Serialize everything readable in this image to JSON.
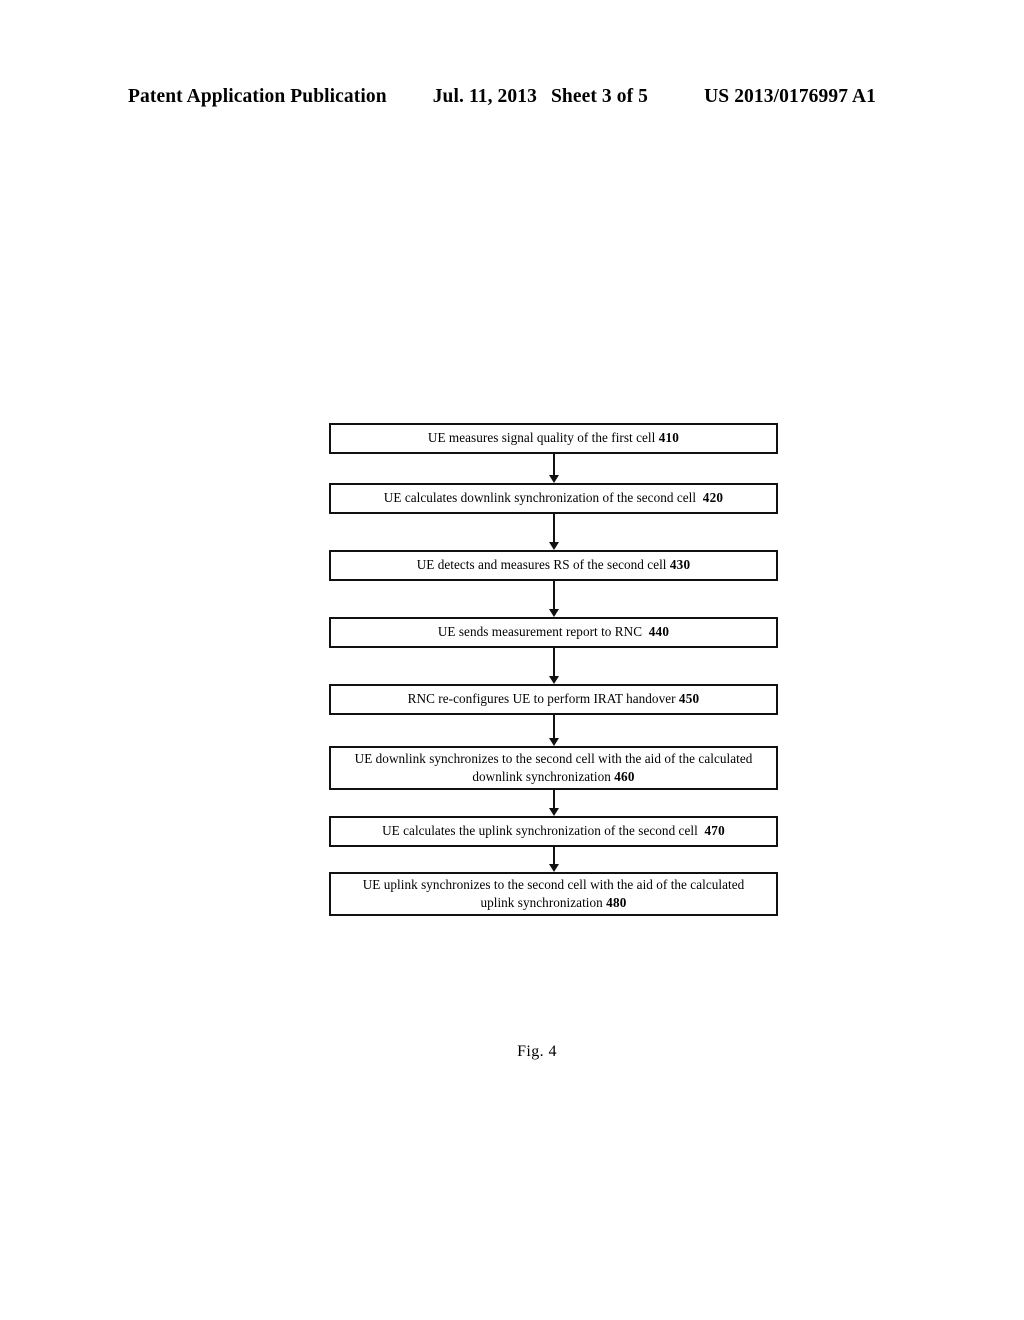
{
  "header": {
    "publication": "Patent Application Publication",
    "date": "Jul. 11, 2013",
    "sheet": "Sheet 3 of 5",
    "patent_number": "US 2013/0176997 A1"
  },
  "figure": {
    "caption": "Fig. 4",
    "nodes": [
      {
        "id": "410",
        "text": "UE measures signal quality of the first cell",
        "ref": "410",
        "lines": 1
      },
      {
        "id": "420",
        "text": "UE calculates downlink synchronization of the second cell",
        "ref": "420",
        "lines": 1
      },
      {
        "id": "430",
        "text": "UE detects and measures RS of the second cell",
        "ref": "430",
        "lines": 1
      },
      {
        "id": "440",
        "text": "UE  sends measurement report to RNC",
        "ref": "440",
        "lines": 1
      },
      {
        "id": "450",
        "text": "RNC re-configures UE to perform IRAT handover",
        "ref": "450",
        "lines": 1
      },
      {
        "id": "460",
        "text": "UE downlink synchronizes to the second cell with the aid of the calculated downlink synchronization",
        "ref": "460",
        "lines": 2
      },
      {
        "id": "470",
        "text": "UE calculates the uplink synchronization of the second cell",
        "ref": "470",
        "lines": 1
      },
      {
        "id": "480",
        "text": "UE uplink synchronizes to the second cell with the aid of the calculated uplink synchronization",
        "ref": "480",
        "lines": 2
      }
    ]
  },
  "colors": {
    "page_background": "#ffffff",
    "ink": "#000000",
    "box_border": "#111111"
  }
}
